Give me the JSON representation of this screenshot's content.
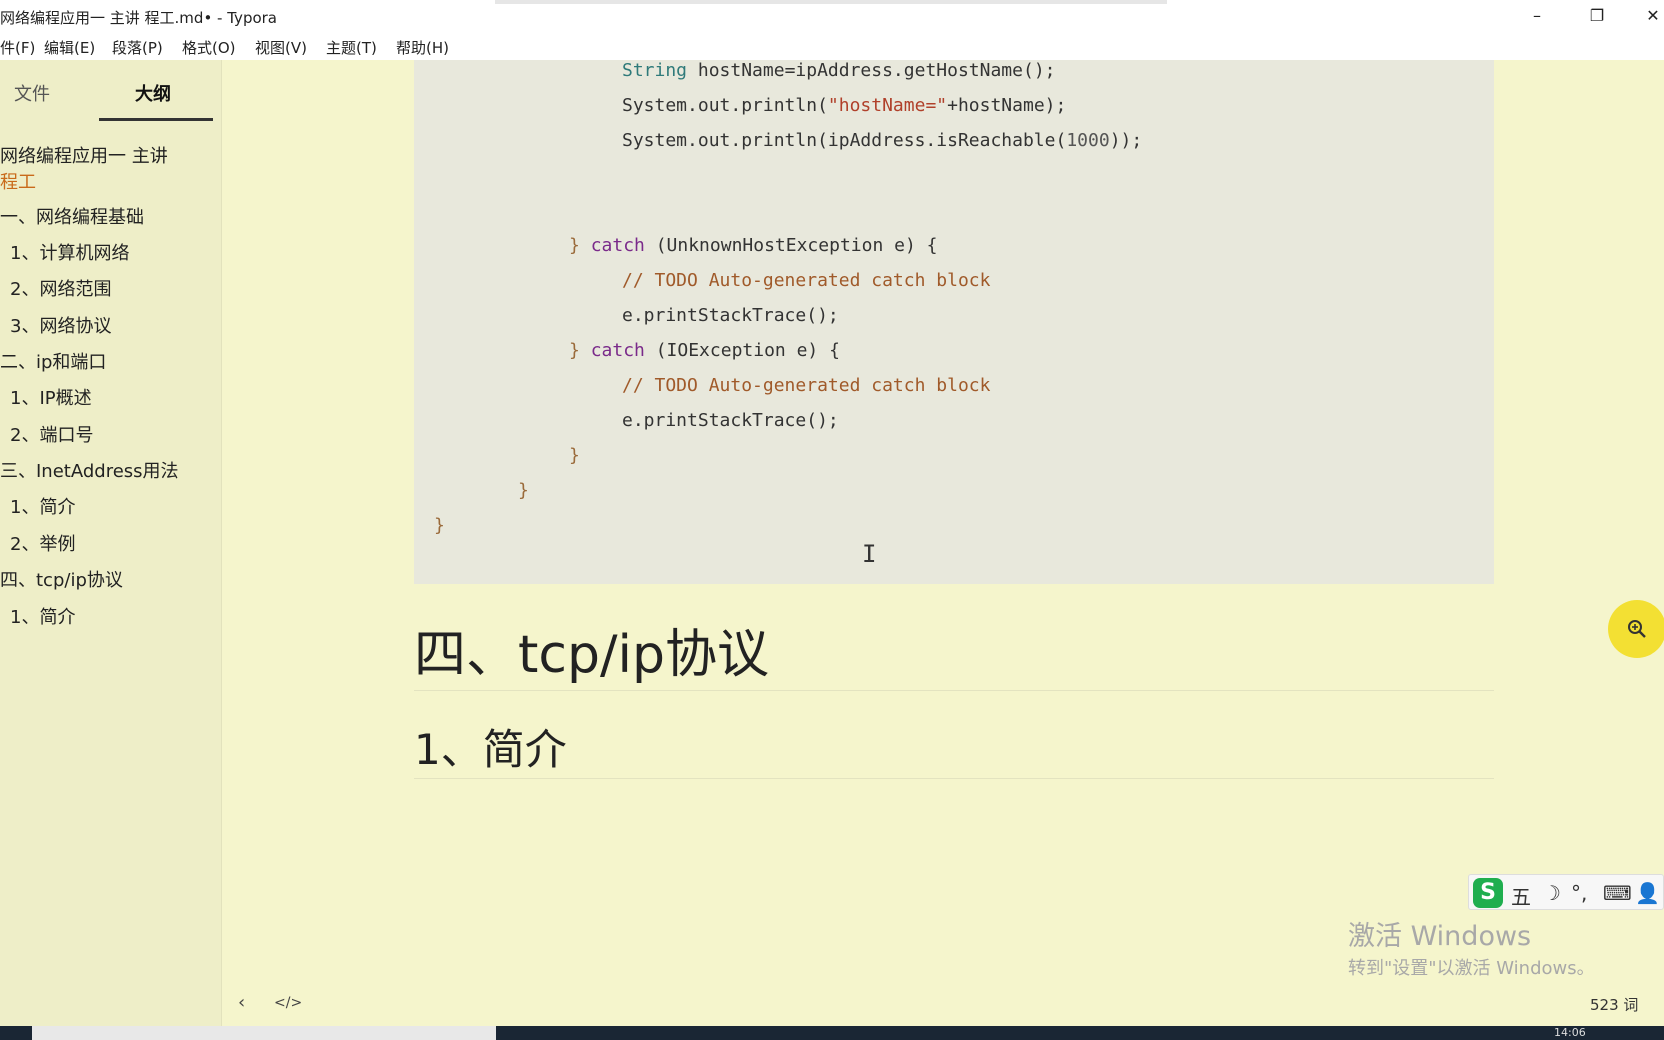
{
  "window": {
    "title": "网络编程应用一      主讲  程工.md• - Typora",
    "min": "–",
    "max": "❐",
    "close": "✕"
  },
  "menu": [
    "件(F)",
    "编辑(E)",
    "段落(P)",
    "格式(O)",
    "视图(V)",
    "主题(T)",
    "帮助(H)"
  ],
  "sidebar": {
    "tabs": [
      "文件",
      "大纲"
    ],
    "active_tab": "大纲",
    "outline": [
      "网络编程应用一  主讲",
      "程工",
      "一、网络编程基础",
      "1、计算机网络",
      "2、网络范围",
      "3、网络协议",
      "二、ip和端口",
      "1、IP概述",
      "2、端口号",
      "三、InetAddress用法",
      "1、简介",
      "2、举例",
      "四、tcp/ip协议",
      "1、简介"
    ]
  },
  "code": {
    "l1_type": "String",
    "l1_rest": " hostName=ipAddress.getHostName();",
    "l2_a": "System.out.println(",
    "l2_str": "\"hostName=\"",
    "l2_b": "+hostName);",
    "l3_a": "System.out.println(ipAddress.isReachable(",
    "l3_num": "1000",
    "l3_b": "));",
    "l4_brace": "} ",
    "l4_kw": "catch",
    "l4_rest": " (UnknownHostException e) {",
    "l5": "// TODO Auto-generated catch block",
    "l6": "e.printStackTrace();",
    "l7_brace": "} ",
    "l7_kw": "catch",
    "l7_rest": " (IOException e) {",
    "l8": "// TODO Auto-generated catch block",
    "l9": "e.printStackTrace();",
    "l10": "}",
    "l11": "}",
    "l12": "}"
  },
  "content": {
    "h1": "四、tcp/ip协议",
    "h2": "1、简介"
  },
  "ime": {
    "logo": "S",
    "mode": "五",
    "moon": "☽",
    "punct": "°,",
    "keyboard": "⌨",
    "user": "👤"
  },
  "watermark": {
    "line1": "激活 Windows",
    "line2": "转到\"设置\"以激活 Windows。"
  },
  "status": {
    "back": "‹",
    "source": "</>",
    "word_count": "523 词"
  },
  "taskbar": {
    "clock": "14:06"
  }
}
